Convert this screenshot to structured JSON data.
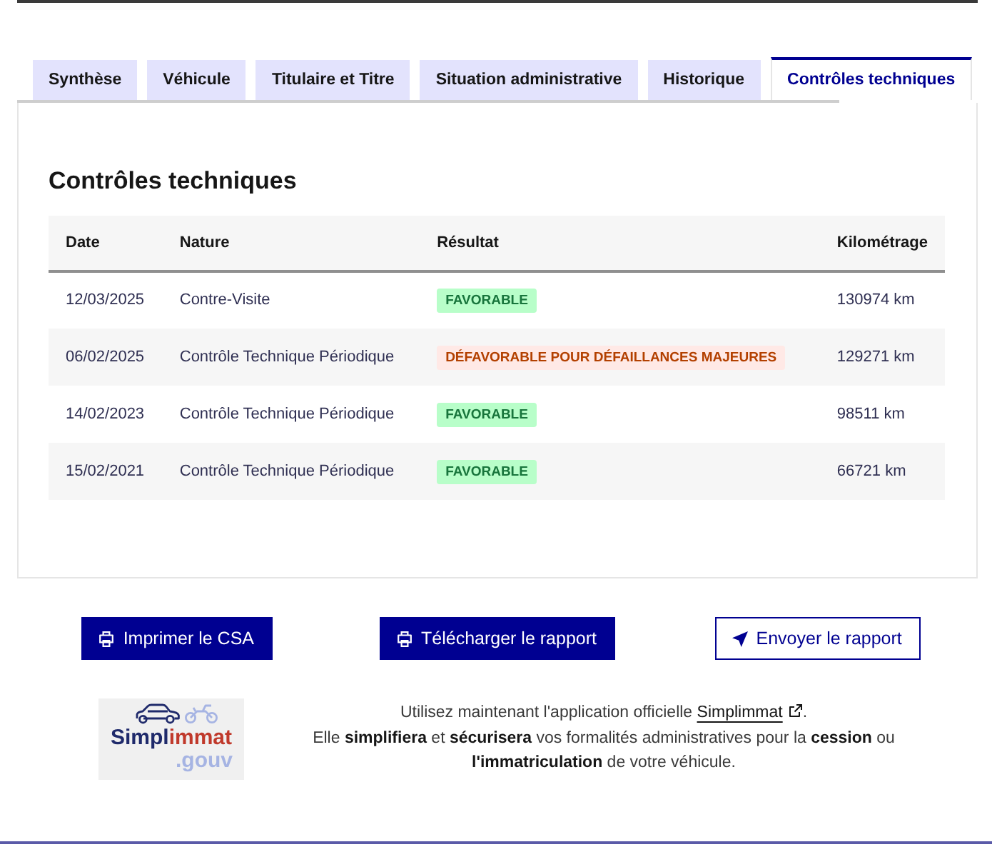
{
  "tabs": [
    {
      "label": "Synthèse",
      "selected": false
    },
    {
      "label": "Véhicule",
      "selected": false
    },
    {
      "label": "Titulaire et Titre",
      "selected": false
    },
    {
      "label": "Situation administrative",
      "selected": false
    },
    {
      "label": "Historique",
      "selected": false
    },
    {
      "label": "Contrôles techniques",
      "selected": true
    }
  ],
  "panel": {
    "title": "Contrôles techniques",
    "table": {
      "columns": [
        "Date",
        "Nature",
        "Résultat",
        "Kilométrage"
      ],
      "rows": [
        {
          "date": "12/03/2025",
          "nature": "Contre-Visite",
          "result": {
            "text": "FAVORABLE",
            "kind": "favorable"
          },
          "mileage": "130974 km"
        },
        {
          "date": "06/02/2025",
          "nature": "Contrôle Technique Périodique",
          "result": {
            "text": "DÉFAVORABLE POUR DÉFAILLANCES MAJEURES",
            "kind": "unfavorable"
          },
          "mileage": "129271 km"
        },
        {
          "date": "14/02/2023",
          "nature": "Contrôle Technique Périodique",
          "result": {
            "text": "FAVORABLE",
            "kind": "favorable"
          },
          "mileage": "98511 km"
        },
        {
          "date": "15/02/2021",
          "nature": "Contrôle Technique Périodique",
          "result": {
            "text": "FAVORABLE",
            "kind": "favorable"
          },
          "mileage": "66721 km"
        }
      ]
    }
  },
  "actions": [
    {
      "label": "Imprimer le CSA",
      "kind": "print"
    },
    {
      "label": "Télécharger le rapport",
      "kind": "download"
    },
    {
      "label": "Envoyer le rapport",
      "kind": "send"
    }
  ],
  "notice": {
    "logo": {
      "wordmark": [
        "Simpl",
        "immat"
      ],
      "suffix": ".gouv"
    },
    "text_before": "Utilisez maintenant l'application officielle",
    "link": "Simplimmat",
    "text_after": ".",
    "body": "Elle **simplifiera** et **sécurisera** vos formalités administratives pour la **cession** ou **l'immatriculation** de votre véhicule."
  }
}
